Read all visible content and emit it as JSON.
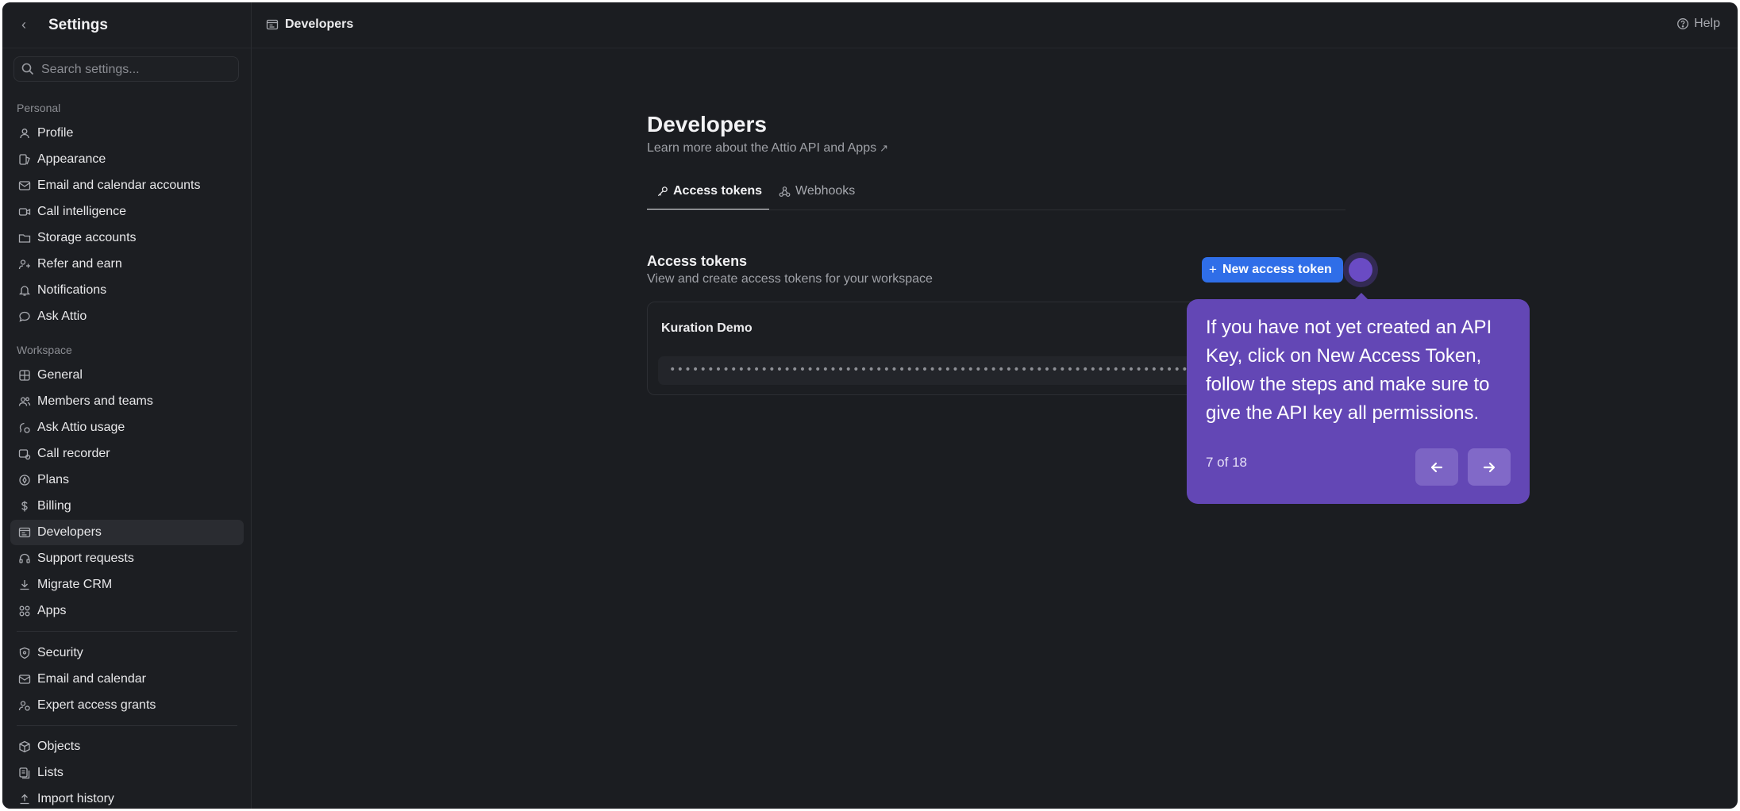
{
  "sidebar": {
    "title": "Settings",
    "search": {
      "placeholder": "Search settings..."
    },
    "sections": {
      "personal": "Personal",
      "workspace": "Workspace"
    },
    "personal_items": [
      {
        "label": "Profile",
        "icon": "user-icon"
      },
      {
        "label": "Appearance",
        "icon": "appearance-icon"
      },
      {
        "label": "Email and calendar accounts",
        "icon": "mail-calendar-icon"
      },
      {
        "label": "Call intelligence",
        "icon": "video-icon"
      },
      {
        "label": "Storage accounts",
        "icon": "folder-icon"
      },
      {
        "label": "Refer and earn",
        "icon": "refer-icon"
      },
      {
        "label": "Notifications",
        "icon": "bell-icon"
      },
      {
        "label": "Ask Attio",
        "icon": "chat-icon"
      }
    ],
    "workspace_items": [
      {
        "label": "General",
        "icon": "grid-icon"
      },
      {
        "label": "Members and teams",
        "icon": "users-icon"
      },
      {
        "label": "Ask Attio usage",
        "icon": "usage-icon"
      },
      {
        "label": "Call recorder",
        "icon": "recorder-icon"
      },
      {
        "label": "Plans",
        "icon": "plans-icon"
      },
      {
        "label": "Billing",
        "icon": "dollar-icon"
      },
      {
        "label": "Developers",
        "icon": "developers-icon"
      },
      {
        "label": "Support requests",
        "icon": "headset-icon"
      },
      {
        "label": "Migrate CRM",
        "icon": "download-icon"
      },
      {
        "label": "Apps",
        "icon": "apps-icon"
      }
    ],
    "security_items": [
      {
        "label": "Security",
        "icon": "shield-icon"
      },
      {
        "label": "Email and calendar",
        "icon": "mail-icon"
      },
      {
        "label": "Expert access grants",
        "icon": "expert-icon"
      }
    ],
    "data_items": [
      {
        "label": "Objects",
        "icon": "cube-icon"
      },
      {
        "label": "Lists",
        "icon": "list-icon"
      },
      {
        "label": "Import history",
        "icon": "upload-icon"
      }
    ],
    "active": "Developers"
  },
  "topbar": {
    "title": "Developers",
    "help": "Help"
  },
  "main": {
    "title": "Developers",
    "subtitle": "Learn more about the Attio API and Apps",
    "subtitle_arrow": "↗",
    "tabs": [
      {
        "label": "Access tokens",
        "active": true
      },
      {
        "label": "Webhooks",
        "active": false
      }
    ],
    "section_title": "Access tokens",
    "section_subtitle": "View and create access tokens for your workspace",
    "new_button": {
      "plus": "+",
      "label": "New access token"
    },
    "token": {
      "name": "Kuration Demo",
      "masked": "•••••••••••••••••••••••••••••••••••••••••••••••••••••••••••••••••••••••••••"
    }
  },
  "tooltip": {
    "text": "If you have not yet created an API Key, click on New Access Token, follow the steps and make sure to give the API key all permissions.",
    "count": "7 of 18"
  },
  "colors": {
    "background": "#1b1d21",
    "accent_button": "#2f6ee8",
    "tooltip": "#6347b5"
  }
}
